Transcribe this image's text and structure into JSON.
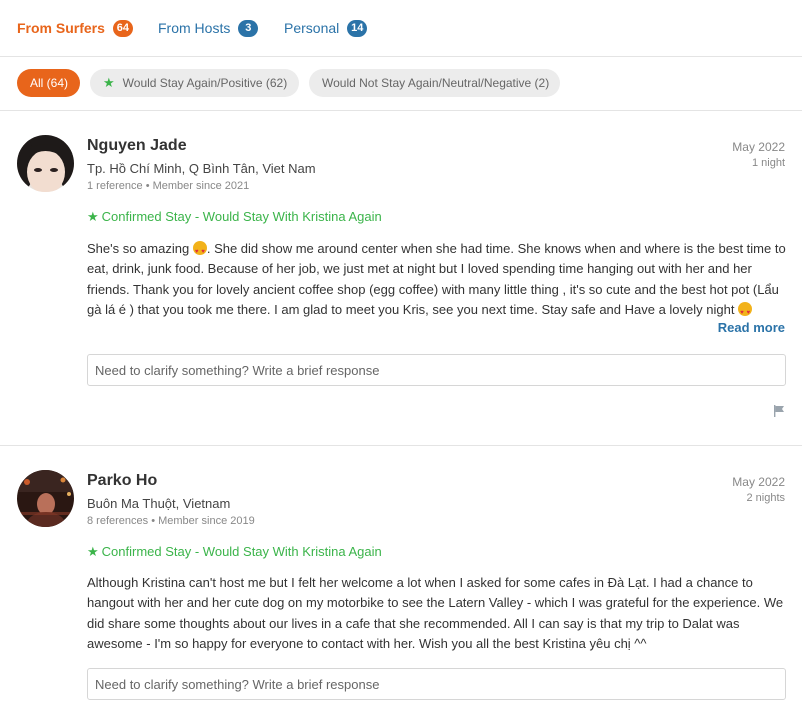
{
  "tabs": [
    {
      "label": "From Surfers",
      "count": "64"
    },
    {
      "label": "From Hosts",
      "count": "3"
    },
    {
      "label": "Personal",
      "count": "14"
    }
  ],
  "filters": [
    {
      "label": "All (64)"
    },
    {
      "label": "Would Stay Again/Positive (62)",
      "icon": "star-icon"
    },
    {
      "label": "Would Not Stay Again/Neutral/Negative (2)"
    }
  ],
  "references": [
    {
      "name": "Nguyen Jade",
      "location": "Tp. Hồ Chí Minh, Q Bình Tân, Viet Nam",
      "meta": "1 reference • Member since 2021",
      "date": "May 2022",
      "duration": "1 night",
      "confirmed": "Confirmed Stay - Would Stay With Kristina Again",
      "text_1": "She's so amazing",
      "text_2": ". She did show me around center when she had time. She knows when and where is the best time to eat, drink, junk food. Because of her job, we just met at night but I loved spending time hanging out with her and her friends. Thank you for lovely ancient coffee shop (egg coffee) with many little thing , it's so cute and the best hot pot (Lẩu gà lá é ) that you took me there. I am glad to meet you Kris, see you next time. Stay safe and Have a lovely night",
      "read_more": "Read more",
      "response_placeholder": "Need to clarify something? Write a brief response"
    },
    {
      "name": "Parko Ho",
      "location": "Buôn Ma Thuột, Vietnam",
      "meta": "8 references • Member since 2019",
      "date": "May 2022",
      "duration": "2 nights",
      "confirmed": "Confirmed Stay - Would Stay With Kristina Again",
      "text": "Although Kristina can't host me but I felt her welcome a lot when I asked for some cafes in Đà Lạt. I had a chance to hangout with her and her cute dog on my motorbike to see the Latern Valley - which I was grateful for the experience. We did share some thoughts about our lives in a cafe that she recommended. All I can say is that my trip to Dalat was awesome - I'm so happy for everyone to contact with her. Wish you all the best Kristina yêu chị ^^",
      "response_placeholder": "Need to clarify something? Write a brief response"
    }
  ],
  "colors": {
    "accent": "#e8651b",
    "link": "#2b73a8",
    "success": "#3bb44a"
  }
}
